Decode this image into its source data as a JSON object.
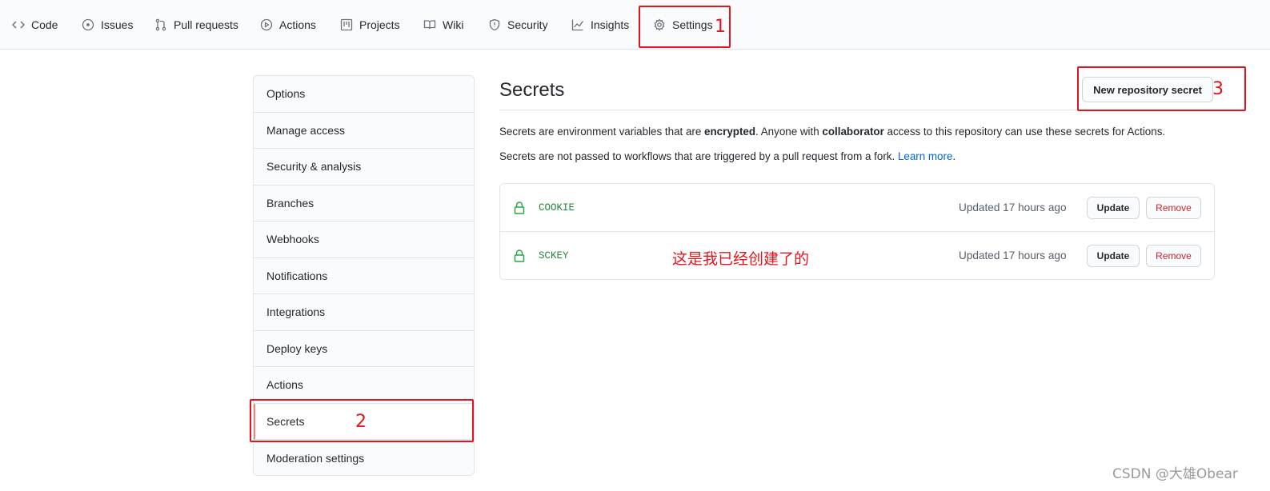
{
  "nav": {
    "tabs": [
      {
        "label": "Code",
        "icon": "code-icon"
      },
      {
        "label": "Issues",
        "icon": "issue-opened-icon"
      },
      {
        "label": "Pull requests",
        "icon": "git-pull-request-icon"
      },
      {
        "label": "Actions",
        "icon": "play-icon"
      },
      {
        "label": "Projects",
        "icon": "project-icon"
      },
      {
        "label": "Wiki",
        "icon": "book-icon"
      },
      {
        "label": "Security",
        "icon": "shield-icon"
      },
      {
        "label": "Insights",
        "icon": "graph-icon"
      },
      {
        "label": "Settings",
        "icon": "gear-icon"
      }
    ],
    "selected": "Settings"
  },
  "sidebar": {
    "items": [
      {
        "label": "Options"
      },
      {
        "label": "Manage access"
      },
      {
        "label": "Security & analysis"
      },
      {
        "label": "Branches"
      },
      {
        "label": "Webhooks"
      },
      {
        "label": "Notifications"
      },
      {
        "label": "Integrations"
      },
      {
        "label": "Deploy keys"
      },
      {
        "label": "Actions"
      },
      {
        "label": "Secrets"
      },
      {
        "label": "Moderation settings"
      }
    ],
    "selected": "Secrets"
  },
  "main": {
    "title": "Secrets",
    "new_button": "New repository secret",
    "para1": {
      "t1": "Secrets are environment variables that are ",
      "b1": "encrypted",
      "t2": ". Anyone with ",
      "b2": "collaborator",
      "t3": " access to this repository can use these secrets for Actions."
    },
    "para2": {
      "t1": "Secrets are not passed to workflows that are triggered by a pull request from a fork. ",
      "link": "Learn more",
      "t2": "."
    },
    "secrets": [
      {
        "name": "COOKIE",
        "updated": "Updated 17 hours ago",
        "update_label": "Update",
        "remove_label": "Remove"
      },
      {
        "name": "SCKEY",
        "updated": "Updated 17 hours ago",
        "update_label": "Update",
        "remove_label": "Remove"
      }
    ]
  },
  "annotations": {
    "num1": "1",
    "num2": "2",
    "num3": "3",
    "note": "这是我已经创建了的",
    "color": "#e5141c"
  },
  "watermark": "CSDN @大雄Obear",
  "colors": {
    "link": "#0366d6",
    "secret_name": "#22863a",
    "lock": "#28a745",
    "remove": "#cb2431",
    "selected_marker": "#f9826c"
  }
}
